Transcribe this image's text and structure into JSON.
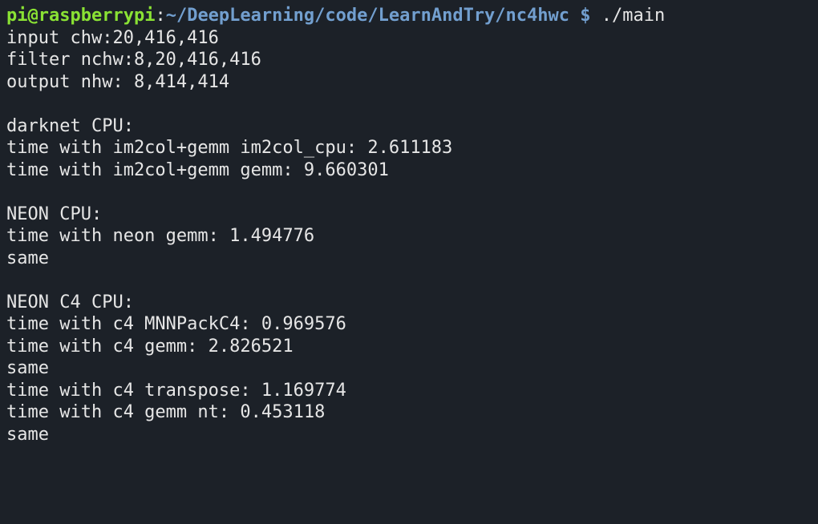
{
  "prompt": {
    "user": "pi",
    "at": "@",
    "host": "raspberrypi",
    "colon": ":",
    "path": "~/DeepLearning/code/LearnAndTry/nc4hwc",
    "dollar": " $ ",
    "command": "./main"
  },
  "output": {
    "line1": "input chw:20,416,416",
    "line2": "filter nchw:8,20,416,416",
    "line3": "output nhw: 8,414,414",
    "line4": "",
    "line5": "darknet CPU:",
    "line6": "time with im2col+gemm im2col_cpu: 2.611183",
    "line7": "time with im2col+gemm gemm: 9.660301",
    "line8": "",
    "line9": "NEON CPU:",
    "line10": "time with neon gemm: 1.494776",
    "line11": "same",
    "line12": "",
    "line13": "NEON C4 CPU:",
    "line14": "time with c4 MNNPackC4: 0.969576",
    "line15": "time with c4 gemm: 2.826521",
    "line16": "same",
    "line17": "time with c4 transpose: 1.169774",
    "line18": "time with c4 gemm nt: 0.453118",
    "line19": "same"
  }
}
